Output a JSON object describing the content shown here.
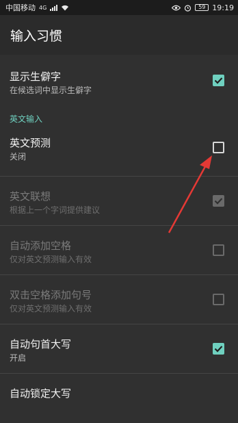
{
  "status_bar": {
    "carrier": "中国移动",
    "network": "4G",
    "battery": "59",
    "time": "19:19"
  },
  "app_bar": {
    "title": "输入习惯"
  },
  "settings": [
    {
      "title": "显示生僻字",
      "summary": "在候选词中显示生僻字",
      "checked": true,
      "enabled": true
    },
    {
      "category": "英文输入"
    },
    {
      "title": "英文预测",
      "summary": "关闭",
      "checked": false,
      "enabled": true
    },
    {
      "title": "英文联想",
      "summary": "根据上一个字词提供建议",
      "checked": true,
      "enabled": false
    },
    {
      "title": "自动添加空格",
      "summary": "仅对英文预测输入有效",
      "checked": false,
      "enabled": false
    },
    {
      "title": "双击空格添加句号",
      "summary": "仅对英文预测输入有效",
      "checked": false,
      "enabled": false
    },
    {
      "title": "自动句首大写",
      "summary": "开启",
      "checked": true,
      "enabled": true
    },
    {
      "title": "自动锁定大写",
      "summary": "",
      "checked": false,
      "enabled": true
    }
  ],
  "colors": {
    "accent": "#6fd0bf",
    "annotation_arrow": "#e53935"
  },
  "icons": [
    "cellular-signal-icon",
    "wifi-icon",
    "eye-icon",
    "alarm-clock-icon",
    "battery-icon",
    "checkmark-icon",
    "annotation-arrow"
  ]
}
